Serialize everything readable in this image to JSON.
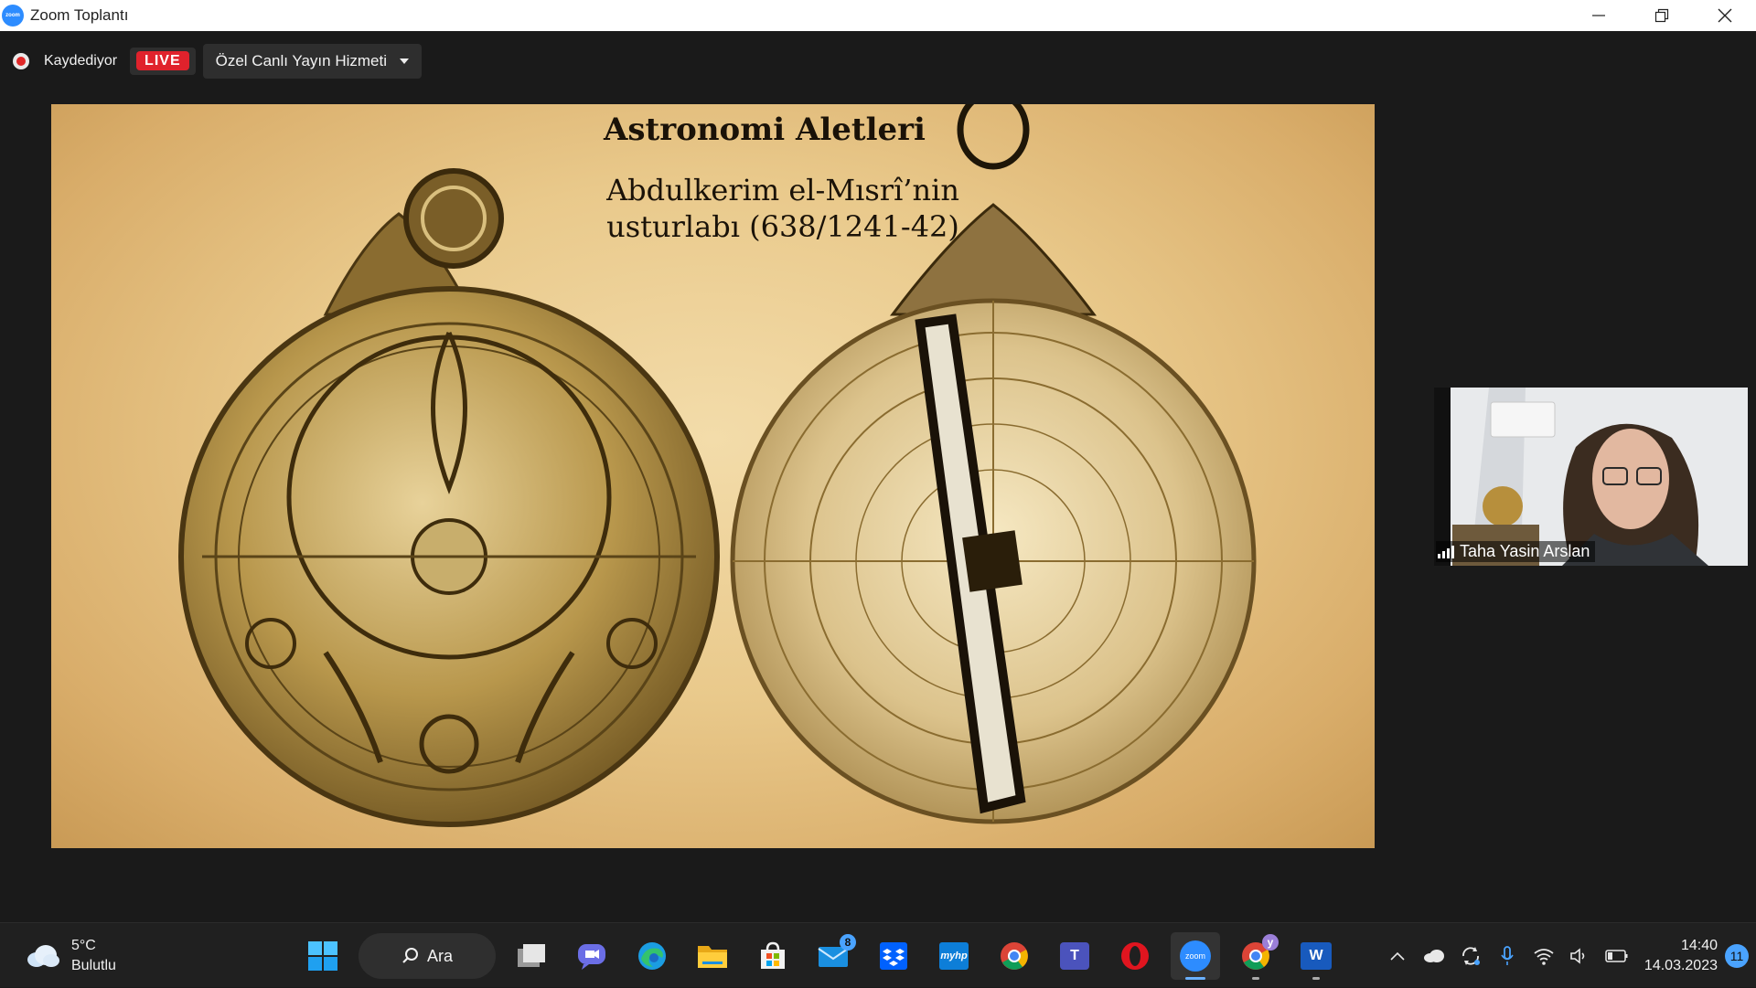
{
  "window": {
    "title": "Zoom Toplantı",
    "logo_text": "zoom"
  },
  "recording": {
    "status_text": "Kaydediyor",
    "live_label": "LIVE",
    "stream_service": "Özel Canlı Yayın Hizmeti"
  },
  "slide": {
    "title": "Astronomi Aletleri",
    "subtitle_line1": "Abdulkerim el-Mısrî’nin",
    "subtitle_line2": "usturlabı (638/1241-42)"
  },
  "participant": {
    "name": "Taha Yasin Arslan"
  },
  "taskbar": {
    "weather_temp": "5°C",
    "weather_desc": "Bulutlu",
    "search_label": "Ara",
    "mail_badge": "8",
    "chrome_profile_badge": "y",
    "hp_label": "myhp",
    "zoom_label": "zoom",
    "teams_label": "T",
    "word_label": "W",
    "time": "14:40",
    "date": "14.03.2023",
    "notification_count": "11"
  },
  "colors": {
    "zoom_blue": "#2d8cff",
    "live_red": "#e0222c",
    "slide_parchment": "#e9c98b",
    "taskbar_bg": "#202020"
  }
}
